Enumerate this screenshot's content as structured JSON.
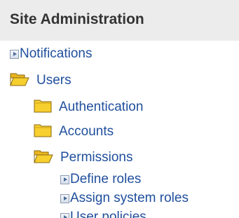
{
  "header": {
    "title": "Site Administration"
  },
  "tree": {
    "notifications": {
      "label": "Notifications",
      "icon": "leaf-arrow-icon"
    },
    "users": {
      "label": "Users",
      "icon": "folder-open-icon"
    },
    "authentication": {
      "label": "Authentication",
      "icon": "folder-closed-icon"
    },
    "accounts": {
      "label": "Accounts",
      "icon": "folder-closed-icon"
    },
    "permissions": {
      "label": "Permissions",
      "icon": "folder-open-icon"
    },
    "define_roles": {
      "label": "Define roles",
      "icon": "leaf-arrow-icon"
    },
    "assign_system_roles": {
      "label": "Assign system roles",
      "icon": "leaf-arrow-icon"
    },
    "user_policies": {
      "label": "User policies",
      "icon": "leaf-arrow-icon"
    }
  },
  "colors": {
    "link": "#1f4f9d",
    "header_bg": "#ececec",
    "folder_yellow": "#f7cf2e"
  }
}
